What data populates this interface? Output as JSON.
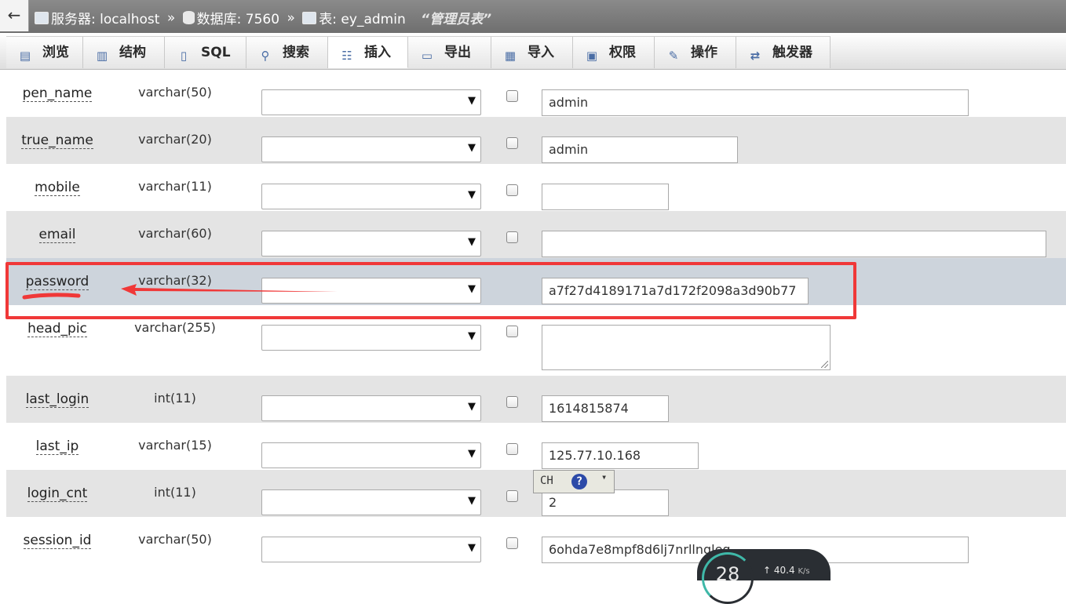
{
  "topbar": {
    "back_symbol": "←",
    "server_label": "服务器: localhost",
    "db_label": "数据库: 7560",
    "table_label": "表: ey_admin",
    "separator": "»",
    "table_comment": "“管理员表”"
  },
  "tabs": [
    {
      "label": "浏览",
      "icon": "browse-icon"
    },
    {
      "label": "结构",
      "icon": "structure-icon"
    },
    {
      "label": "SQL",
      "icon": "sql-icon"
    },
    {
      "label": "搜索",
      "icon": "search-icon"
    },
    {
      "label": "插入",
      "icon": "insert-icon",
      "active": true
    },
    {
      "label": "导出",
      "icon": "export-icon"
    },
    {
      "label": "导入",
      "icon": "import-icon"
    },
    {
      "label": "权限",
      "icon": "privileges-icon"
    },
    {
      "label": "操作",
      "icon": "operations-icon"
    },
    {
      "label": "触发器",
      "icon": "triggers-icon"
    }
  ],
  "fields": [
    {
      "name": "pen_name",
      "type": "varchar(50)",
      "value": "admin"
    },
    {
      "name": "true_name",
      "type": "varchar(20)",
      "value": "admin"
    },
    {
      "name": "mobile",
      "type": "varchar(11)",
      "value": ""
    },
    {
      "name": "email",
      "type": "varchar(60)",
      "value": ""
    },
    {
      "name": "password",
      "type": "varchar(32)",
      "value": "a7f27d4189171a7d172f2098a3d90b77"
    },
    {
      "name": "head_pic",
      "type": "varchar(255)",
      "value": ""
    },
    {
      "name": "last_login",
      "type": "int(11)",
      "value": "1614815874"
    },
    {
      "name": "last_ip",
      "type": "varchar(15)",
      "value": "125.77.10.168"
    },
    {
      "name": "login_cnt",
      "type": "int(11)",
      "value": "2"
    },
    {
      "name": "session_id",
      "type": "varchar(50)",
      "value": "6ohda7e8mpf8d6lj7nrllngleg"
    }
  ],
  "ime": {
    "mode": "CH",
    "help": "?",
    "more": "▾"
  },
  "speed_widget": {
    "gauge": "28",
    "rate": "40.4",
    "unit": "K/s",
    "arrow": "↑"
  },
  "colors": {
    "annotation": "#f03838",
    "highlight_row": "#cdd4dc",
    "alt_row": "#e4e4e4"
  }
}
